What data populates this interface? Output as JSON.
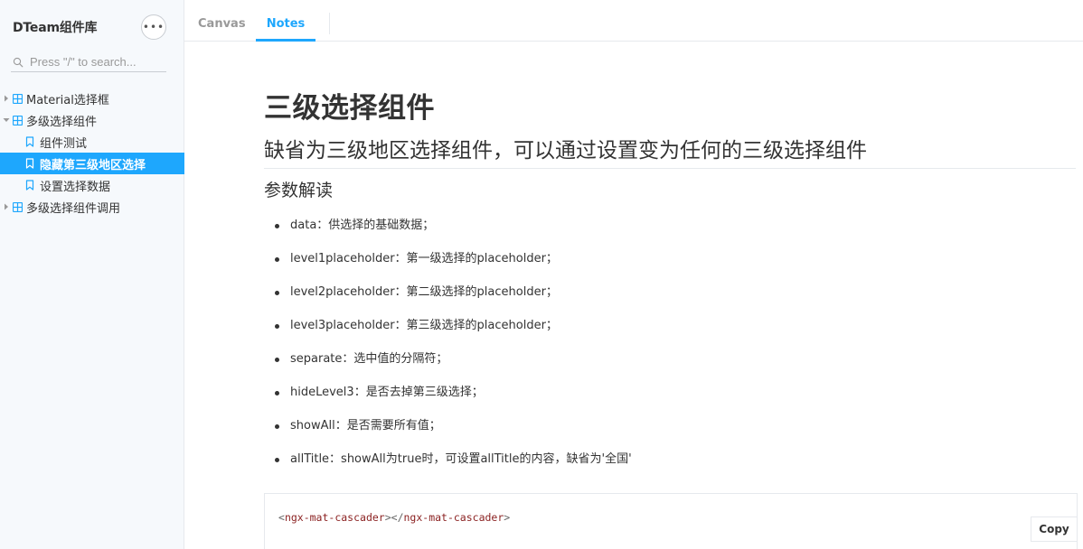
{
  "sidebar": {
    "brand": "DTeam组件库",
    "more_label": "•••",
    "search": {
      "placeholder": "Press \"/\" to search..."
    },
    "items": [
      {
        "label": "Material选择框",
        "type": "component",
        "expanded": false
      },
      {
        "label": "多级选择组件",
        "type": "component",
        "expanded": true
      },
      {
        "label": "组件测试",
        "type": "story"
      },
      {
        "label": "隐藏第三级地区选择",
        "type": "story",
        "selected": true
      },
      {
        "label": "设置选择数据",
        "type": "story"
      },
      {
        "label": "多级选择组件调用",
        "type": "component",
        "expanded": false
      }
    ]
  },
  "tabs": [
    {
      "label": "Canvas",
      "active": false
    },
    {
      "label": "Notes",
      "active": true
    }
  ],
  "doc": {
    "title": "三级选择组件",
    "subtitle": "缺省为三级地区选择组件，可以通过设置变为任何的三级选择组件",
    "section": "参数解读",
    "params": [
      "data：供选择的基础数据；",
      "level1placeholder：第一级选择的placeholder；",
      "level2placeholder：第二级选择的placeholder；",
      "level3placeholder：第三级选择的placeholder；",
      "separate：选中值的分隔符；",
      "hideLevel3：是否去掉第三级选择；",
      "showAll：是否需要所有值；",
      "allTitle：showAll为true时，可设置allTitle的内容，缺省为'全国'"
    ],
    "code": {
      "open_lt": "<",
      "open_tag": "ngx-mat-cascader",
      "mid": "></",
      "close_tag": "ngx-mat-cascader",
      "close_gt": ">"
    },
    "copy_label": "Copy"
  },
  "colors": {
    "accent": "#1ea7fd",
    "sidebar_bg": "#f6f9fc",
    "text": "#333333"
  }
}
